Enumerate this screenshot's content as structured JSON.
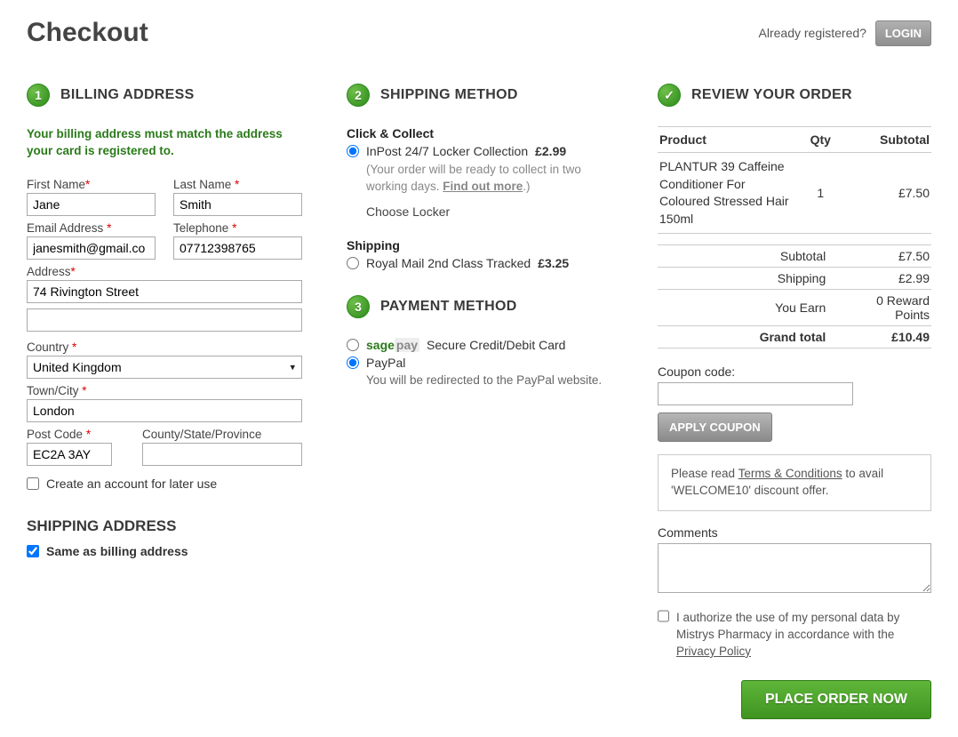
{
  "header": {
    "title": "Checkout",
    "already_registered": "Already registered?",
    "login": "LOGIN"
  },
  "billing": {
    "step": "1",
    "title": "BILLING ADDRESS",
    "notice": "Your billing address must match the address your card is registered to.",
    "labels": {
      "first_name": "First Name",
      "last_name": "Last Name",
      "email": "Email Address",
      "telephone": "Telephone",
      "address": "Address",
      "country": "Country",
      "town": "Town/City",
      "postcode": "Post Code",
      "county": "County/State/Province",
      "create_account": "Create an account for later use"
    },
    "values": {
      "first_name": "Jane",
      "last_name": "Smith",
      "email": "janesmith@gmail.co",
      "telephone": "07712398765",
      "address1": "74 Rivington Street",
      "address2": "",
      "country": "United Kingdom",
      "town": "London",
      "postcode": "EC2A 3AY",
      "county": ""
    }
  },
  "shipping_address": {
    "title": "SHIPPING ADDRESS",
    "same_as_billing": "Same as billing address"
  },
  "shipping_method": {
    "step": "2",
    "title": "SHIPPING METHOD",
    "group1": "Click & Collect",
    "option1_label": "InPost 24/7 Locker Collection",
    "option1_price": "£2.99",
    "option1_note_a": "(Your order will be ready to collect in two working days. ",
    "option1_note_link": "Find out more",
    "option1_note_b": ".)",
    "choose_locker": "Choose Locker",
    "group2": "Shipping",
    "option2_label": "Royal Mail 2nd Class Tracked",
    "option2_price": "£3.25"
  },
  "payment": {
    "step": "3",
    "title": "PAYMENT METHOD",
    "sagepay_label": " Secure Credit/Debit Card",
    "paypal_label": "PayPal",
    "paypal_note": "You will be redirected to the PayPal website."
  },
  "review": {
    "title": "REVIEW YOUR ORDER",
    "headers": {
      "product": "Product",
      "qty": "Qty",
      "subtotal": "Subtotal"
    },
    "items": [
      {
        "name": "PLANTUR 39 Caffeine Conditioner For Coloured Stressed Hair 150ml",
        "qty": "1",
        "subtotal": "£7.50"
      }
    ],
    "totals": {
      "subtotal_label": "Subtotal",
      "subtotal": "£7.50",
      "shipping_label": "Shipping",
      "shipping": "£2.99",
      "earn_label": "You Earn",
      "earn": "0 Reward Points",
      "grand_label": "Grand total",
      "grand": "£10.49"
    },
    "coupon_label": "Coupon code:",
    "apply_coupon": "APPLY COUPON",
    "terms_a": "Please read ",
    "terms_link": "Terms & Conditions",
    "terms_b": " to avail 'WELCOME10' discount offer.",
    "comments_label": "Comments",
    "auth_a": "I authorize the use of my personal data by Mistrys Pharmacy in accordance with the ",
    "auth_link": "Privacy Policy",
    "place_order": "PLACE ORDER NOW"
  }
}
